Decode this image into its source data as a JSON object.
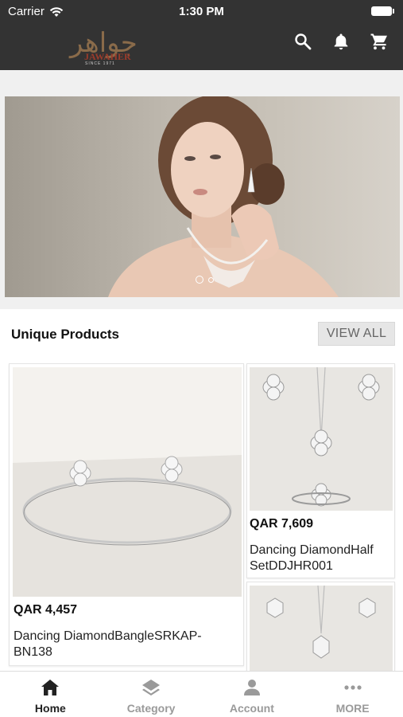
{
  "status_bar": {
    "carrier": "Carrier",
    "time": "1:30 PM"
  },
  "brand": {
    "logo_arabic": "جواهر",
    "logo_english": "JAWAHER",
    "logo_since": "SINCE 1971"
  },
  "header_icons": [
    "search-icon",
    "bell-icon",
    "cart-icon"
  ],
  "banner": {
    "slides": 2,
    "active_slide": 1
  },
  "section": {
    "title": "Unique Products",
    "view_all_label": "VIEW ALL"
  },
  "products": [
    {
      "price": "QAR 4,457",
      "name_line1": "Dancing DiamondBangleSRKAP-",
      "name_line2": "BN138"
    },
    {
      "price": "QAR 7,609",
      "name_line1": "Dancing DiamondHalf",
      "name_line2": "SetDDJHR001"
    },
    {
      "price": "",
      "name_line1": "",
      "name_line2": ""
    }
  ],
  "bottom_nav": [
    {
      "label": "Home",
      "icon": "home-icon",
      "active": true
    },
    {
      "label": "Category",
      "icon": "layers-icon",
      "active": false
    },
    {
      "label": "Account",
      "icon": "person-icon",
      "active": false
    },
    {
      "label": "MORE",
      "icon": "more-dots-icon",
      "active": false
    }
  ],
  "colors": {
    "header_bg": "#333333",
    "active_tab": "#222222",
    "inactive_tab": "#9a9a9a"
  }
}
